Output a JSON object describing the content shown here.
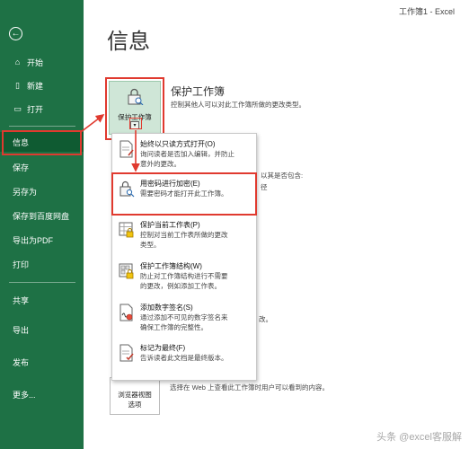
{
  "window": {
    "title": "工作簿1  -  Excel"
  },
  "sidebar": {
    "items": [
      {
        "label": "开始",
        "icon": "home-icon"
      },
      {
        "label": "新建",
        "icon": "new-file-icon"
      },
      {
        "label": "打开",
        "icon": "open-folder-icon"
      },
      {
        "label": "信息"
      },
      {
        "label": "保存"
      },
      {
        "label": "另存为"
      },
      {
        "label": "保存到百度网盘"
      },
      {
        "label": "导出为PDF"
      },
      {
        "label": "打印"
      },
      {
        "label": "共享"
      },
      {
        "label": "导出"
      },
      {
        "label": "发布"
      },
      {
        "label": "更多..."
      }
    ]
  },
  "main": {
    "page_title": "信息",
    "protect": {
      "button_label": "保护工作簿",
      "title": "保护工作簿",
      "description": "控制其他人可以对此工作簿所做的更改类型。"
    },
    "background": {
      "line1": "以其是否包含:",
      "line2": "径",
      "line3": "改。",
      "browser_label_1": "浏览器视图",
      "browser_label_2": "选项",
      "browser_desc": "选择在 Web 上查看此工作簿时用户可以看到的内容。"
    }
  },
  "menu": {
    "items": [
      {
        "title": "始终以只读方式打开(O)",
        "desc1": "询问读者是否加入编辑，并防止",
        "desc2": "意外的更改。"
      },
      {
        "title": "用密码进行加密(E)",
        "desc1": "需要密码才能打开此工作簿。",
        "desc2": ""
      },
      {
        "title": "保护当前工作表(P)",
        "desc1": "控制对当前工作表所做的更改",
        "desc2": "类型。"
      },
      {
        "title": "保护工作簿结构(W)",
        "desc1": "防止对工作簿结构进行不需要",
        "desc2": "的更改，例如添加工作表。"
      },
      {
        "title": "添加数字签名(S)",
        "desc1": "通过添加不可见的数字签名来",
        "desc2": "确保工作簿的完整性。"
      },
      {
        "title": "标记为最终(F)",
        "desc1": "告诉读者此文档是最终版本。",
        "desc2": ""
      }
    ]
  },
  "watermark": "头条 @excel客服解",
  "colors": {
    "sidebar": "#1e7145",
    "highlight": "#e03a2f",
    "accent_bg": "#cfe6d7"
  }
}
